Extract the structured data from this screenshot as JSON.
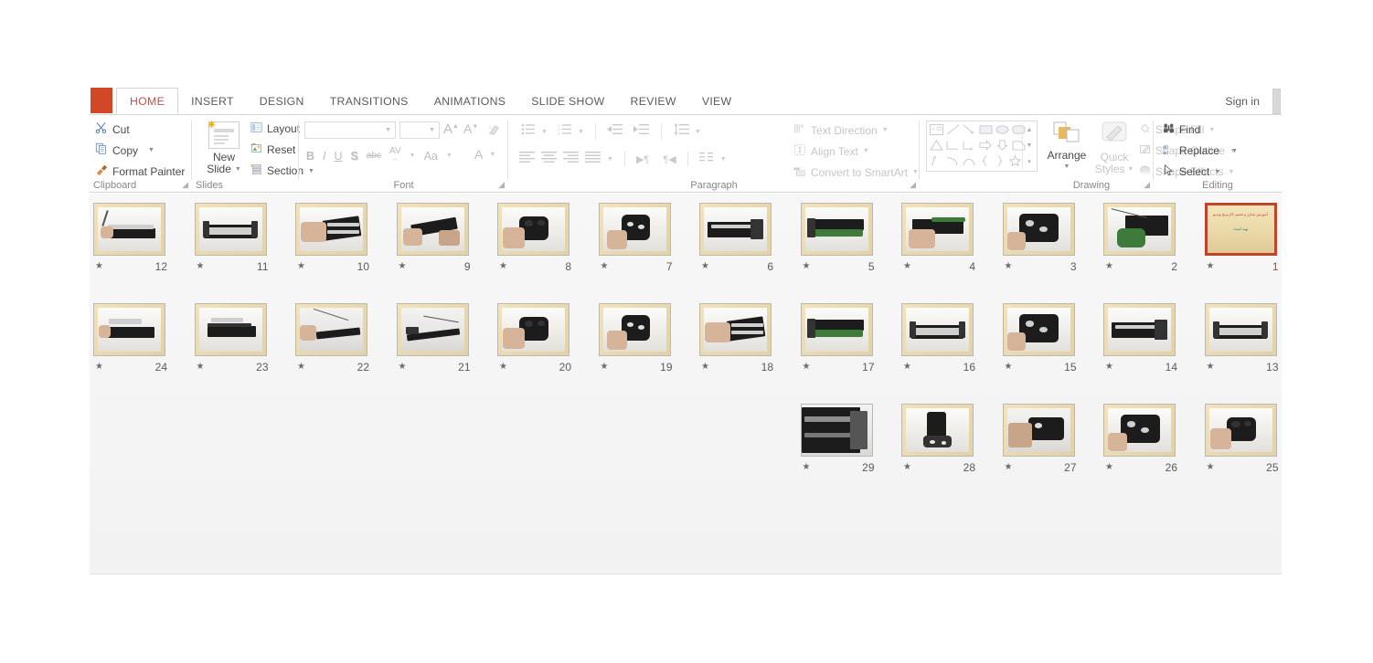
{
  "window": {
    "app_button": "file-tab",
    "sign_in": "Sign in"
  },
  "ribbon": {
    "tabs": [
      {
        "label": "HOME",
        "active": true
      },
      {
        "label": "INSERT",
        "active": false
      },
      {
        "label": "DESIGN",
        "active": false
      },
      {
        "label": "TRANSITIONS",
        "active": false
      },
      {
        "label": "ANIMATIONS",
        "active": false
      },
      {
        "label": "SLIDE SHOW",
        "active": false
      },
      {
        "label": "REVIEW",
        "active": false
      },
      {
        "label": "VIEW",
        "active": false
      }
    ],
    "groups": {
      "clipboard": {
        "label": "Clipboard",
        "cut": "Cut",
        "copy": "Copy",
        "format_painter": "Format Painter"
      },
      "slides": {
        "label": "Slides",
        "new_slide": "New\nSlide",
        "new_slide_line1": "New",
        "new_slide_line2": "Slide",
        "layout": "Layout",
        "reset": "Reset",
        "section": "Section"
      },
      "font": {
        "label": "Font",
        "font_name_value": "",
        "font_size_value": "",
        "bold": "B",
        "italic": "I",
        "underline": "U",
        "shadow": "S",
        "strikethrough": "abc",
        "character_spacing": "AV",
        "change_case": "Aa",
        "font_color": "A",
        "grow_font": "A",
        "shrink_font": "A"
      },
      "paragraph": {
        "label": "Paragraph",
        "text_direction": "Text Direction",
        "align_text": "Align Text",
        "convert_to_smartart": "Convert to SmartArt"
      },
      "drawing": {
        "label": "Drawing",
        "arrange": "Arrange",
        "quick_styles_line1": "Quick",
        "quick_styles_line2": "Styles",
        "shape_fill": "Shape Fill",
        "shape_outline": "Shape Outline",
        "shape_effects": "Shape Effects"
      },
      "editing": {
        "label": "Editing",
        "find": "Find",
        "replace": "Replace",
        "select": "Select"
      }
    }
  },
  "slide_sorter": {
    "columns": 12,
    "selected_slide": 1,
    "total_slides": 29,
    "title_slide": {
      "title_text": "آموزش شارژ و تعمیر کارتریج ویدیو",
      "subtitle_text": "تهیه کننده:"
    },
    "slides": [
      {
        "number": "12",
        "star": "★",
        "row": 0,
        "col": 0,
        "kind": "drum-unit-tool",
        "selected": false
      },
      {
        "number": "11",
        "star": "★",
        "row": 0,
        "col": 1,
        "kind": "drum-unit-open",
        "selected": false
      },
      {
        "number": "10",
        "star": "★",
        "row": 0,
        "col": 2,
        "kind": "hand-blade",
        "selected": false
      },
      {
        "number": "9",
        "star": "★",
        "row": 0,
        "col": 3,
        "kind": "cartridge-hands",
        "selected": false
      },
      {
        "number": "8",
        "star": "★",
        "row": 0,
        "col": 4,
        "kind": "gear-end",
        "selected": false
      },
      {
        "number": "7",
        "star": "★",
        "row": 0,
        "col": 5,
        "kind": "gear-end2",
        "selected": false
      },
      {
        "number": "6",
        "star": "★",
        "row": 0,
        "col": 6,
        "kind": "cartridge-flat",
        "selected": false
      },
      {
        "number": "5",
        "star": "★",
        "row": 0,
        "col": 7,
        "kind": "drum-green",
        "selected": false
      },
      {
        "number": "4",
        "star": "★",
        "row": 0,
        "col": 8,
        "kind": "hand-hold",
        "selected": false
      },
      {
        "number": "3",
        "star": "★",
        "row": 0,
        "col": 9,
        "kind": "end-cap",
        "selected": false
      },
      {
        "number": "2",
        "star": "★",
        "row": 0,
        "col": 10,
        "kind": "green-drum",
        "selected": false
      },
      {
        "number": "1",
        "star": "★",
        "row": 0,
        "col": 11,
        "kind": "title",
        "selected": true
      },
      {
        "number": "24",
        "star": "★",
        "row": 1,
        "col": 0,
        "kind": "toner-bar",
        "selected": false
      },
      {
        "number": "23",
        "star": "★",
        "row": 1,
        "col": 1,
        "kind": "toner-bar2",
        "selected": false
      },
      {
        "number": "22",
        "star": "★",
        "row": 1,
        "col": 2,
        "kind": "thin-tool",
        "selected": false
      },
      {
        "number": "21",
        "star": "★",
        "row": 1,
        "col": 3,
        "kind": "blade-wide",
        "selected": false
      },
      {
        "number": "20",
        "star": "★",
        "row": 1,
        "col": 4,
        "kind": "gear-end",
        "selected": false
      },
      {
        "number": "19",
        "star": "★",
        "row": 1,
        "col": 5,
        "kind": "gear-end2",
        "selected": false
      },
      {
        "number": "18",
        "star": "★",
        "row": 1,
        "col": 6,
        "kind": "hand-blade",
        "selected": false
      },
      {
        "number": "17",
        "star": "★",
        "row": 1,
        "col": 7,
        "kind": "drum-green",
        "selected": false
      },
      {
        "number": "16",
        "star": "★",
        "row": 1,
        "col": 8,
        "kind": "drum-unit-open",
        "selected": false
      },
      {
        "number": "15",
        "star": "★",
        "row": 1,
        "col": 9,
        "kind": "end-cap",
        "selected": false
      },
      {
        "number": "14",
        "star": "★",
        "row": 1,
        "col": 10,
        "kind": "cartridge-flat",
        "selected": false
      },
      {
        "number": "13",
        "star": "★",
        "row": 1,
        "col": 11,
        "kind": "drum-unit-open",
        "selected": false
      },
      {
        "number": "29",
        "star": "★",
        "row": 2,
        "col": 7,
        "kind": "closeup",
        "selected": false
      },
      {
        "number": "28",
        "star": "★",
        "row": 2,
        "col": 8,
        "kind": "upright",
        "selected": false
      },
      {
        "number": "27",
        "star": "★",
        "row": 2,
        "col": 9,
        "kind": "hand-hold2",
        "selected": false
      },
      {
        "number": "26",
        "star": "★",
        "row": 2,
        "col": 10,
        "kind": "end-cap",
        "selected": false
      },
      {
        "number": "25",
        "star": "★",
        "row": 2,
        "col": 11,
        "kind": "gear-end",
        "selected": false
      }
    ]
  },
  "colors": {
    "accent": "#d24726",
    "active_tab_text": "#c0504d",
    "selection_border": "#c0432a",
    "ribbon_text": "#4a4a4a",
    "group_label": "#878787"
  }
}
